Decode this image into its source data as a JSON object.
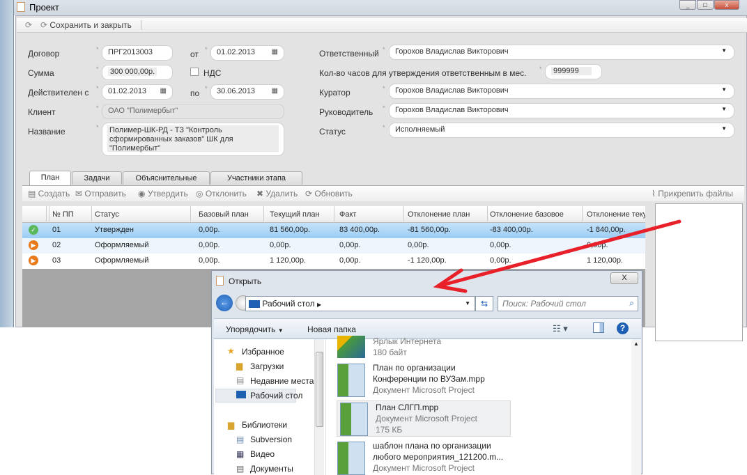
{
  "window": {
    "title": "Проект",
    "controls": [
      "_",
      "□",
      "x"
    ]
  },
  "toolbar": {
    "save_close": "Сохранить и закрыть"
  },
  "form": {
    "contract_label": "Договор",
    "contract": "ПРГ2013003",
    "from_label": "от",
    "from_date": "01.02.2013",
    "sum_label": "Сумма",
    "sum": "300 000,00р.",
    "vat_label": "НДС",
    "vat_checked": false,
    "valid_label": "Действителен с",
    "valid_from": "01.02.2013",
    "to_label": "по",
    "valid_to": "30.06.2013",
    "client_label": "Клиент",
    "client": "ОАО \"Полимербыт\"",
    "name_label": "Название",
    "name": "Полимер-ШК-РД - ТЗ \"Контроль сформированных заказов\" ШК для \"Полимербыт\"",
    "responsible_label": "Ответственный",
    "responsible": "Горохов Владислав Викторович",
    "hours_label": "Кол-во часов для утверждения ответственным в мес.",
    "hours": "999999",
    "curator_label": "Куратор",
    "curator": "Горохов Владислав Викторович",
    "manager_label": "Руководитель",
    "manager": "Горохов Владислав Викторович",
    "status_label": "Статус",
    "status": "Исполняемый",
    "required_mark": "*"
  },
  "tabs": [
    {
      "label": "План"
    },
    {
      "label": "Задачи"
    },
    {
      "label": "Объяснительные"
    },
    {
      "label": "Участники этапа"
    }
  ],
  "gridbar": {
    "create": "Создать",
    "send": "Отправить",
    "approve": "Утвердить",
    "reject": "Отклонить",
    "delete": "Удалить",
    "refresh": "Обновить",
    "attach": "Прикрепить файлы"
  },
  "grid": {
    "columns": [
      "№ ПП",
      "Статус",
      "Базовый план",
      "Текущий план",
      "Факт",
      "Отклонение план",
      "Отклонение базовое",
      "Отклонение теку"
    ],
    "rows": [
      {
        "icon": "check-icon",
        "cells": [
          "01",
          "Утвержден",
          "0,00р.",
          "81 560,00р.",
          "83 400,00р.",
          "-81 560,00р.",
          "-83 400,00р.",
          "-1 840,00р."
        ]
      },
      {
        "icon": "play-icon",
        "cells": [
          "02",
          "Оформляемый",
          "0,00р.",
          "0,00р.",
          "0,00р.",
          "0,00р.",
          "0,00р.",
          "0,00р."
        ]
      },
      {
        "icon": "play-icon",
        "cells": [
          "03",
          "Оформляемый",
          "0,00р.",
          "1 120,00р.",
          "0,00р.",
          "-1 120,00р.",
          "0,00р.",
          "1 120,00р."
        ]
      }
    ]
  },
  "dialog": {
    "title": "Открыть",
    "address": "Рабочий стол",
    "search_placeholder": "Поиск: Рабочий стол",
    "organize": "Упорядочить",
    "new_folder": "Новая папка",
    "close": "X",
    "nav": {
      "favorites": "Избранное",
      "downloads": "Загрузки",
      "recent": "Недавние места",
      "desktop": "Рабочий стол",
      "libraries": "Библиотеки",
      "subversion": "Subversion",
      "video": "Видео",
      "documents": "Документы"
    },
    "files": [
      {
        "line1": "Ярлык Интернета",
        "line2": "180 байт"
      },
      {
        "line1": "План по организации",
        "line2": "Конференции по ВУЗам.mpp",
        "line3": "Документ Microsoft Project"
      },
      {
        "line1": "План СЛГП.mpp",
        "line2": "Документ Microsoft Project",
        "line3": "175 КБ"
      },
      {
        "line1": "шаблон плана по организации",
        "line2": "любого мероприятия_121200.m...",
        "line3": "Документ Microsoft Project"
      }
    ]
  },
  "colors": {
    "selected_row": "#a9d3f5",
    "annotation_arrow": "#e8202a",
    "dialog_accent": "#1e5fb4"
  }
}
